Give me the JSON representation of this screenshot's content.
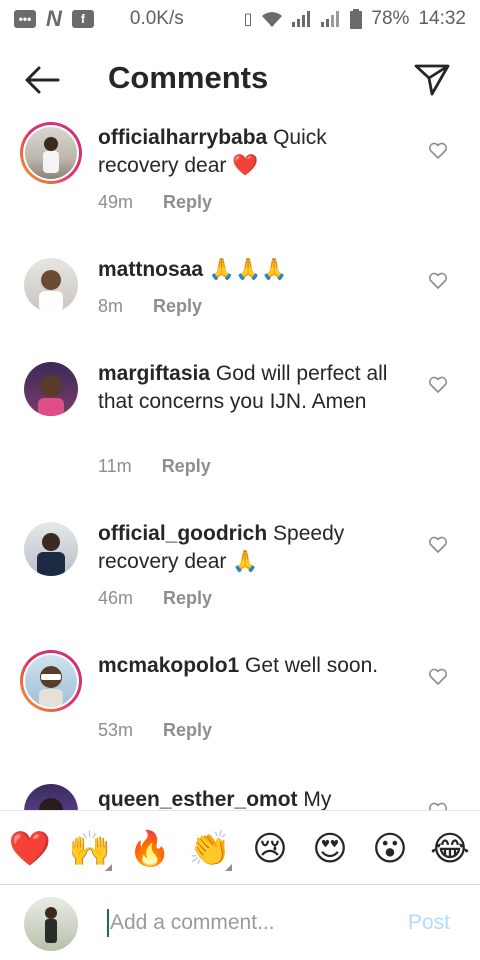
{
  "status_bar": {
    "speed": "0.0K/s",
    "battery": "78%",
    "time": "14:32"
  },
  "header": {
    "title": "Comments",
    "back_icon": "arrow-left-icon",
    "send_icon": "paper-plane-icon"
  },
  "comments": [
    {
      "username": "officialharrybaba",
      "text": " Quick recovery dear ❤️",
      "time": "49m",
      "reply": "Reply"
    },
    {
      "username": "mattnosaa",
      "text": " 🙏🙏🙏",
      "time": "8m",
      "reply": "Reply"
    },
    {
      "username": "margiftasia",
      "text": " God will perfect all that concerns you IJN. Amen",
      "time": "11m",
      "reply": "Reply"
    },
    {
      "username": "official_goodrich",
      "text": " Speedy recovery dear 🙏",
      "time": "46m",
      "reply": "Reply"
    },
    {
      "username": "mcmakopolo1",
      "text": " Get well soon.",
      "time": "53m",
      "reply": "Reply"
    },
    {
      "username": "queen_esther_omot",
      "text": " My",
      "time": "",
      "reply": ""
    }
  ],
  "emoji_bar": [
    "❤️",
    "🙌",
    "🔥",
    "👏",
    "😢",
    "😍",
    "😮",
    "😂"
  ],
  "input": {
    "placeholder": "Add a comment...",
    "post_label": "Post"
  },
  "colors": {
    "post_disabled": "#b3dbff",
    "story_ring_start": "#f5a623",
    "story_ring_end": "#c13584"
  }
}
